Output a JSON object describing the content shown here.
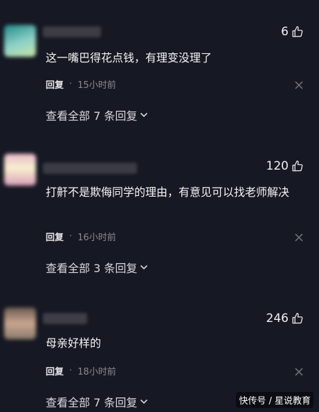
{
  "comments": [
    {
      "likes": "6",
      "text": "这一嘴巴得花点钱，有理变没理了",
      "reply_label": "回复",
      "dot": "·",
      "time": "15小时前",
      "expand": "查看全部 7 条回复",
      "avatar_colors": [
        "#1f8a8a",
        "#8fd1c8",
        "#c7e7a6"
      ],
      "name_color": "#3b3c45"
    },
    {
      "likes": "120",
      "text": "打鼾不是欺侮同学的理由，有意见可以找老师解决",
      "reply_label": "回复",
      "dot": "·",
      "time": "16小时前",
      "expand": "查看全部 3 条回复",
      "avatar_colors": [
        "#e7b8c8",
        "#f7f0d0",
        "#d9a0b8"
      ],
      "name_color": "#3a3b44"
    },
    {
      "likes": "246",
      "text": "母亲好样的",
      "reply_label": "回复",
      "dot": "·",
      "time": "18小时前",
      "expand": "查看全部 7 条回复",
      "avatar_colors": [
        "#6b5a52",
        "#c9a68f",
        "#8b7a6e"
      ],
      "name_color": "#3d3e47"
    }
  ],
  "watermark": "快传号 / 星说教育"
}
